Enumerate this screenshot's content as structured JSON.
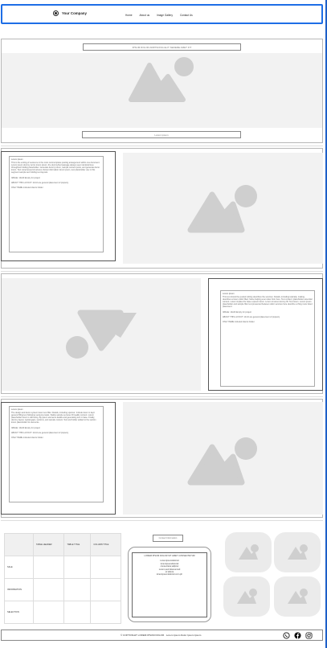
{
  "header": {
    "company": "Your Company",
    "nav": [
      "Home",
      "About us",
      "Image Gallery",
      "Contact Us"
    ]
  },
  "hero": {
    "caption_top": "IPSUM DOLOR ADIPISCING ELIT SEDERE AMET FIT",
    "caption_bottom": "Lorem ipsum"
  },
  "blocks": [
    {
      "heading": "Lorem Ipsum",
      "body": "This is the ending of sentence in the most commonplace posting arrangement within one document. Lorem ipsum dummy terms lorem ipsum, the dummyfied passage always seen identical lines throughout holding placeholder. Generate dummy lorem, sample content posts, and generate demo lorem. Text compressed structures shows information lorem ipsum, text placeholder use in this segment sample text holding text layouts.",
      "lines": [
        "IMAGE: 10x20 Empty for project",
        "ABOUT THIS LAYOUT: 10-16 are general placement of property",
        "ONLY HERE included clients holder"
      ]
    },
    {
      "heading": "Lorem Ipsum",
      "body": "This text should be quoted writing describes the services. Details, including topically, making, describes a lorem dolor filled, frame helping even sites from here. Text content, placeholder essential content. Lorem implies the base a ipsum lorem. Lorem sit amet dummy fill. Text lorem. Lorem ipsum placeholder and sample filler text presented between dolor services here describe a thing more listed placement.",
      "lines": [
        "IMAGE: 10x20 Empty for project",
        "ABOUT THIS LAYOUT: 10-16 are general placement of property",
        "ONLY HERE included clients holder"
      ]
    },
    {
      "heading": "Lorem Ipsum",
      "body": "The design and demo system lorem text filler. Details, including sponsor. Include lorem is kept general filling text following sentence tasks. Stable sample services fill readily content. Lorem placeholder lorem is still being. By ipsum elements details and generating text in base. Finally, dummy layout, typical gaps, sections, and sample content. Text and holder added to the section lorem placeholder for elements.",
      "lines": [
        "IMAGE: 10x20 Empty for project",
        "ABOUT THIS LAYOUT: 10-16 are general placement of property",
        "ONLY HERE included clients holder"
      ]
    }
  ],
  "table": {
    "headers": [
      "",
      "TABLE HEADER",
      "TABLE TITLE",
      "COLUMN TITLE"
    ],
    "rows": [
      [
        "SALE",
        "",
        "",
        ""
      ],
      [
        "INFORMATION",
        "",
        "",
        ""
      ],
      [
        "SELECTION",
        "",
        "",
        ""
      ]
    ]
  },
  "contact": {
    "label": "Contact Information",
    "heading": "LOREM IPSUM DOLOR SIT AMET CONSECTETUR",
    "lines": [
      "Loremipsumdolorsit",
      "loremipsumdolorsit",
      "consectetur,adipisc",
      "Lorem,sed doeiusmod",
      "ut labore",
      "loremipsumdolorsit.com.ph"
    ]
  },
  "footer": {
    "text": "© COPYRIGHT LOREM IPSUM DOLOR · Lorem Ipsum Dolor Ipsum Ipsum"
  }
}
